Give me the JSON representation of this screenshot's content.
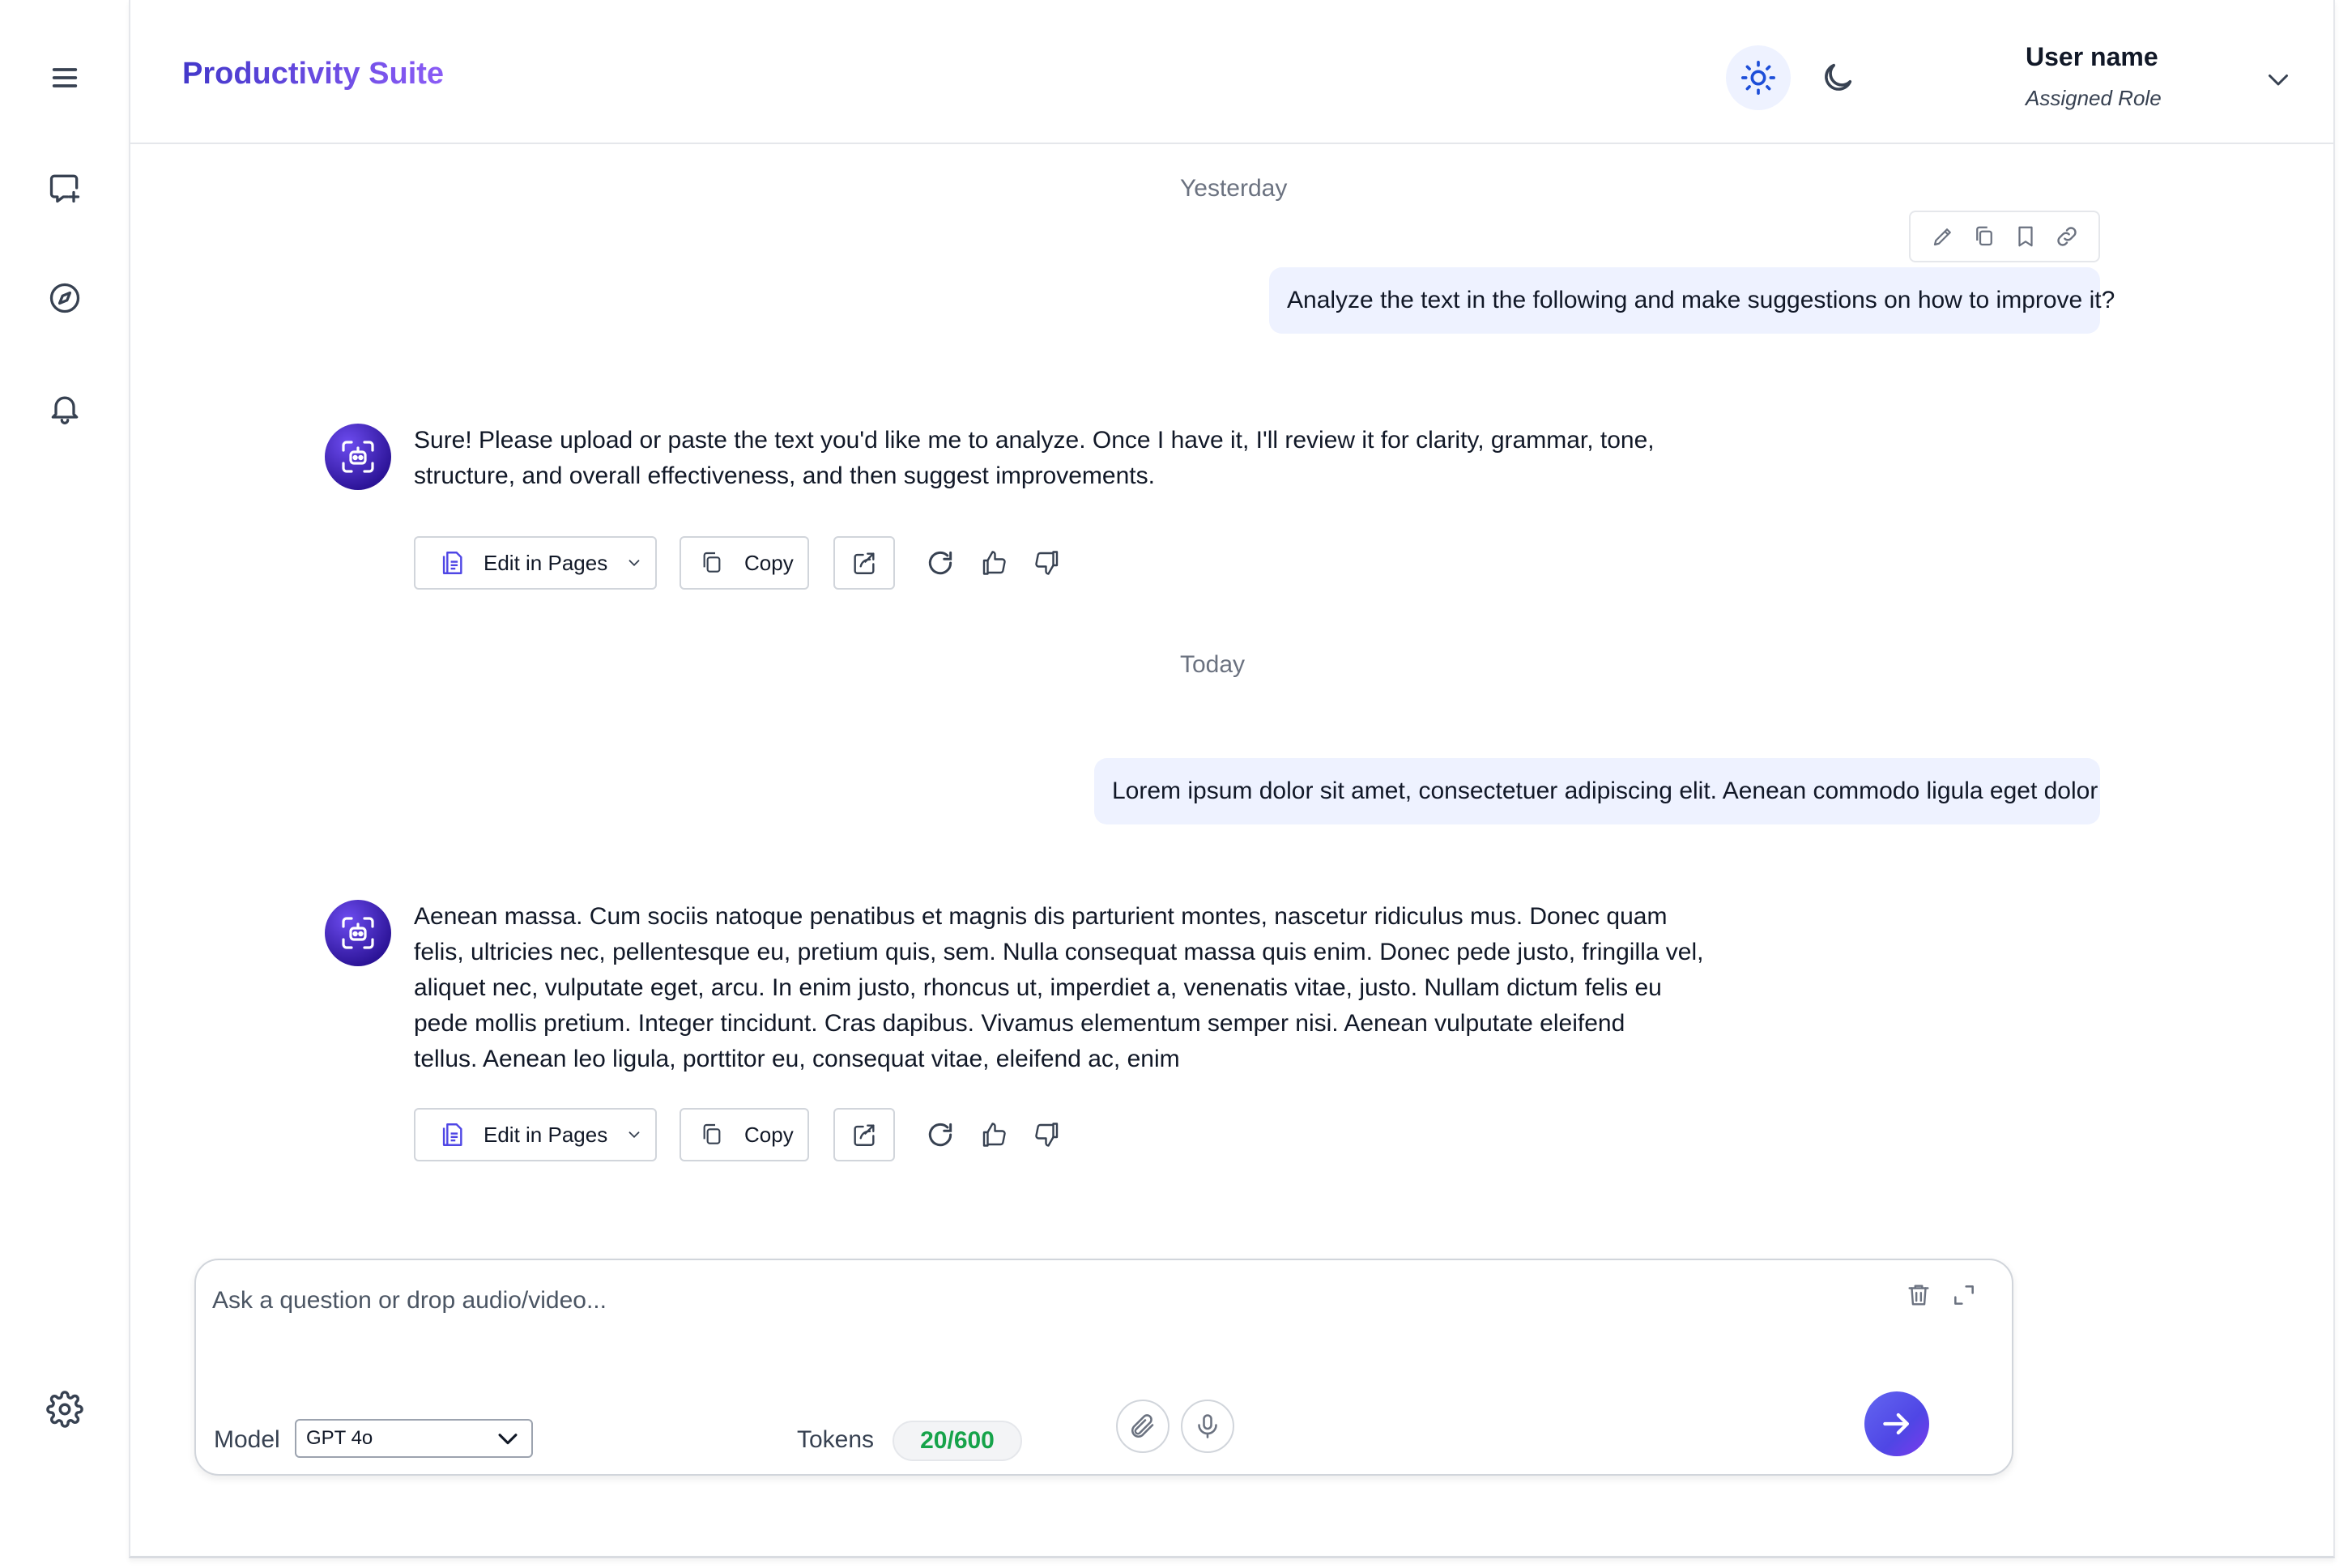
{
  "app": {
    "title": "Productivity Suite"
  },
  "sidebar": {
    "items": [
      {
        "icon": "menu-icon"
      },
      {
        "icon": "new-chat-icon"
      },
      {
        "icon": "compass-icon"
      },
      {
        "icon": "bell-icon"
      },
      {
        "icon": "gear-icon"
      }
    ]
  },
  "header": {
    "theme_light_icon": "sun-icon",
    "theme_dark_icon": "moon-icon",
    "user": {
      "name": "User name",
      "role": "Assigned Role"
    }
  },
  "conversation": {
    "groups": [
      {
        "day": "Yesterday",
        "user_message": "Analyze the text in the following and make suggestions on how to improve it?",
        "bot_message": [
          "Sure! Please upload or paste the text you'd like me to analyze. Once I have it, I'll review it for clarity, grammar, tone,",
          "structure, and overall effectiveness, and then suggest improvements."
        ]
      },
      {
        "day": "Today",
        "user_message": "Lorem ipsum dolor sit amet, consectetuer adipiscing elit. Aenean commodo ligula eget dolor",
        "bot_message": [
          "Aenean massa. Cum sociis natoque penatibus et magnis dis parturient montes, nascetur ridiculus mus. Donec quam",
          "felis, ultricies nec, pellentesque eu, pretium quis, sem. Nulla consequat massa quis enim. Donec pede justo, fringilla vel,",
          "aliquet nec, vulputate eget, arcu. In enim justo, rhoncus ut, imperdiet a, venenatis vitae, justo. Nullam dictum felis eu",
          "pede mollis pretium. Integer tincidunt. Cras dapibus. Vivamus elementum semper nisi. Aenean vulputate eleifend",
          "tellus. Aenean leo ligula, porttitor eu, consequat vitae, eleifend ac, enim"
        ]
      }
    ],
    "actions": {
      "edit_label": "Edit in Pages",
      "copy_label": "Copy"
    }
  },
  "composer": {
    "placeholder": "Ask a question or drop audio/video...",
    "model_label": "Model",
    "model_value": "GPT 4o",
    "tokens_label": "Tokens",
    "tokens_value": "20/600"
  },
  "colors": {
    "accent": "#4f46e5",
    "bubble": "#eef2ff",
    "tokens": "#16a34a"
  }
}
